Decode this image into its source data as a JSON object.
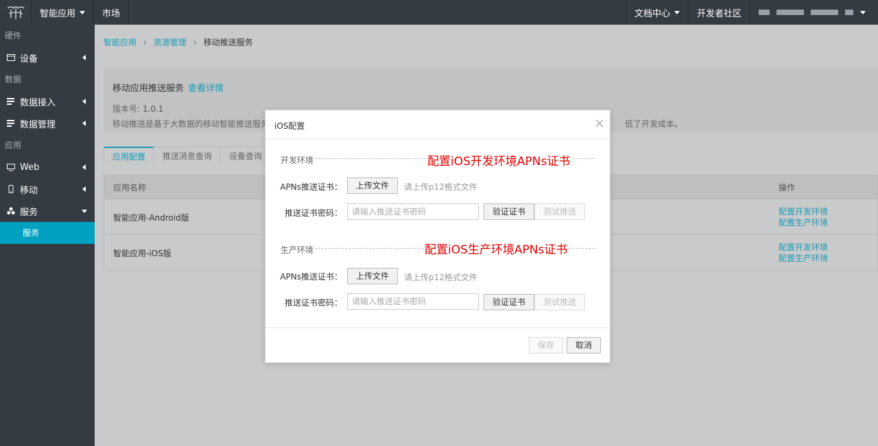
{
  "topbar": {
    "nav": [
      {
        "label": "智能应用",
        "dropdown": true
      },
      {
        "label": "市场",
        "dropdown": false
      }
    ],
    "right": [
      {
        "label": "文档中心",
        "dropdown": true
      },
      {
        "label": "开发者社区",
        "dropdown": false
      }
    ]
  },
  "sidebar": {
    "groups": [
      {
        "label": "硬件",
        "items": [
          {
            "label": "设备",
            "icon": "device-icon"
          }
        ]
      },
      {
        "label": "数据",
        "items": [
          {
            "label": "数据接入",
            "icon": "data-icon"
          },
          {
            "label": "数据管理",
            "icon": "data-icon"
          }
        ]
      },
      {
        "label": "应用",
        "items": [
          {
            "label": "Web",
            "icon": "monitor-icon"
          },
          {
            "label": "移动",
            "icon": "mobile-icon"
          },
          {
            "label": "服务",
            "icon": "service-icon"
          }
        ]
      }
    ],
    "active_sub": "服务"
  },
  "breadcrumb": {
    "items": [
      "智能应用",
      "资源管理",
      "移动推送服务"
    ]
  },
  "info": {
    "title": "移动应用推送服务",
    "details_link": "查看详情",
    "version_label": "版本号:",
    "version": "1.0.1",
    "description_start": "移动推送是基于大数据的移动智能推送服务",
    "description_end": "低了开发成本。"
  },
  "tabs": [
    "应用配置",
    "推送消息查询",
    "设备查询"
  ],
  "table": {
    "headers": {
      "name": "应用名称",
      "ops": "操作"
    },
    "rows": [
      {
        "name": "智能应用-Android版",
        "op1": "配置开发环境",
        "op2": "配置生产环境"
      },
      {
        "name": "智能应用-iOS版",
        "op1": "配置开发环境",
        "op2": "配置生产环境"
      }
    ]
  },
  "modal": {
    "title": "iOS配置",
    "dev": {
      "section": "开发环境",
      "annotation": "配置iOS开发环境APNs证书",
      "cert_label": "APNs推送证书：",
      "upload": "上传文件",
      "upload_hint": "请上传p12格式文件",
      "pwd_label": "推送证书密码：",
      "pwd_placeholder": "请输入推送证书密码",
      "verify": "验证证书",
      "test": "测试推送"
    },
    "prod": {
      "section": "生产环境",
      "annotation": "配置iOS生产环境APNs证书",
      "cert_label": "APNs推送证书：",
      "upload": "上传文件",
      "upload_hint": "请上传p12格式文件",
      "pwd_label": "推送证书密码：",
      "pwd_placeholder": "请输入推送证书密码",
      "verify": "验证证书",
      "test": "测试推送"
    },
    "save": "保存",
    "cancel": "取消"
  },
  "colors": {
    "accent": "#1a9cb7",
    "sidebar_active": "#00a0c0",
    "annotation": "#e00000"
  }
}
